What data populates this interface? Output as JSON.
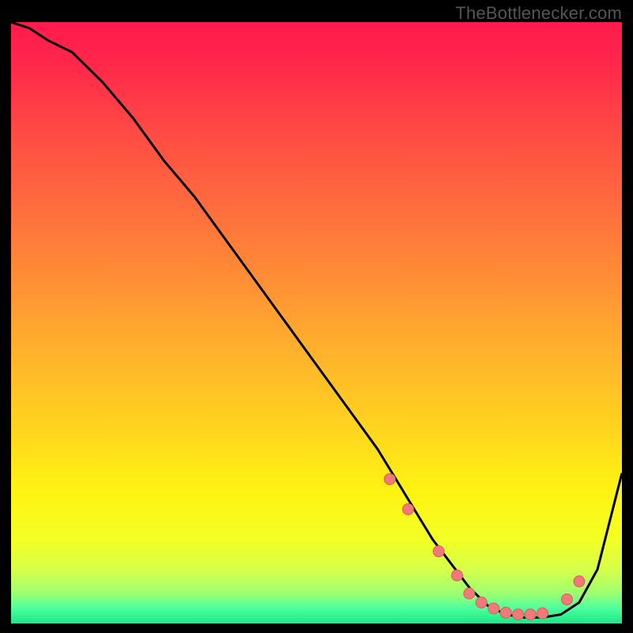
{
  "watermark": "TheBottlenecker.com",
  "colors": {
    "black": "#000000",
    "curve": "#000000",
    "dot_fill": "#f07a7a",
    "dot_stroke": "#e25a5a"
  },
  "gradient_stops": [
    {
      "offset": 0.0,
      "color": "#ff1a4d"
    },
    {
      "offset": 0.08,
      "color": "#ff2a4a"
    },
    {
      "offset": 0.18,
      "color": "#ff4a44"
    },
    {
      "offset": 0.3,
      "color": "#ff6a3e"
    },
    {
      "offset": 0.42,
      "color": "#ff8c36"
    },
    {
      "offset": 0.55,
      "color": "#ffb22c"
    },
    {
      "offset": 0.68,
      "color": "#ffd61e"
    },
    {
      "offset": 0.78,
      "color": "#fff312"
    },
    {
      "offset": 0.86,
      "color": "#f4ff24"
    },
    {
      "offset": 0.91,
      "color": "#d6ff4a"
    },
    {
      "offset": 0.95,
      "color": "#9dff70"
    },
    {
      "offset": 0.975,
      "color": "#4dffa0"
    },
    {
      "offset": 1.0,
      "color": "#18e884"
    }
  ],
  "chart_data": {
    "type": "line",
    "title": "",
    "xlabel": "",
    "ylabel": "",
    "xlim": [
      0,
      100
    ],
    "ylim": [
      0,
      100
    ],
    "series": [
      {
        "name": "bottleneck-curve",
        "x": [
          0,
          3,
          6,
          10,
          15,
          20,
          25,
          30,
          35,
          40,
          45,
          50,
          55,
          60,
          63,
          66,
          69,
          72,
          75,
          78,
          81,
          84,
          87,
          90,
          93,
          96,
          100
        ],
        "y": [
          100,
          99,
          97,
          95,
          90,
          84,
          77,
          71,
          64,
          57,
          50,
          43,
          36,
          29,
          24,
          19,
          14,
          10,
          6,
          3,
          1.5,
          1,
          1,
          1.5,
          3.5,
          9,
          25
        ]
      }
    ],
    "markers": {
      "name": "highlight-dots",
      "x": [
        62,
        65,
        70,
        73,
        75,
        77,
        79,
        81,
        83,
        85,
        87,
        91,
        93
      ],
      "y": [
        24,
        19,
        12,
        8,
        5,
        3.5,
        2.5,
        1.8,
        1.5,
        1.5,
        1.7,
        4,
        7
      ]
    }
  }
}
